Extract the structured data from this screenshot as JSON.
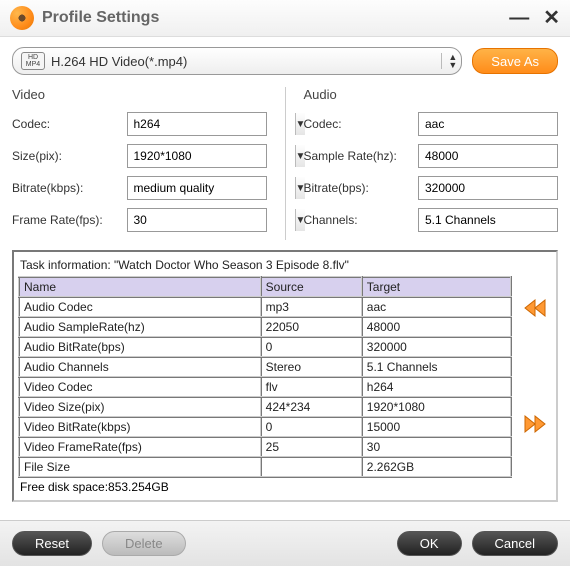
{
  "window": {
    "title": "Profile Settings"
  },
  "profile": {
    "name": "H.264 HD Video(*.mp4)",
    "icon_top": "HD",
    "icon_bottom": "MP4"
  },
  "buttons": {
    "saveas": "Save As",
    "reset": "Reset",
    "delete": "Delete",
    "ok": "OK",
    "cancel": "Cancel"
  },
  "video": {
    "heading": "Video",
    "codec_label": "Codec:",
    "codec_value": "h264",
    "size_label": "Size(pix):",
    "size_value": "1920*1080",
    "bitrate_label": "Bitrate(kbps):",
    "bitrate_value": "medium quality",
    "framerate_label": "Frame Rate(fps):",
    "framerate_value": "30"
  },
  "audio": {
    "heading": "Audio",
    "codec_label": "Codec:",
    "codec_value": "aac",
    "samplerate_label": "Sample Rate(hz):",
    "samplerate_value": "48000",
    "bitrate_label": "Bitrate(bps):",
    "bitrate_value": "320000",
    "channels_label": "Channels:",
    "channels_value": "5.1 Channels"
  },
  "task": {
    "info": "Task information: \"Watch Doctor Who Season 3 Episode 8.flv\"",
    "headers": [
      "Name",
      "Source",
      "Target"
    ],
    "rows": [
      [
        "Audio Codec",
        "mp3",
        "aac"
      ],
      [
        "Audio SampleRate(hz)",
        "22050",
        "48000"
      ],
      [
        "Audio BitRate(bps)",
        "0",
        "320000"
      ],
      [
        "Audio Channels",
        "Stereo",
        "5.1 Channels"
      ],
      [
        "Video Codec",
        "flv",
        "h264"
      ],
      [
        "Video Size(pix)",
        "424*234",
        "1920*1080"
      ],
      [
        "Video BitRate(kbps)",
        "0",
        "15000"
      ],
      [
        "Video FrameRate(fps)",
        "25",
        "30"
      ],
      [
        "File Size",
        "",
        "2.262GB"
      ]
    ],
    "freespace": "Free disk space:853.254GB"
  }
}
